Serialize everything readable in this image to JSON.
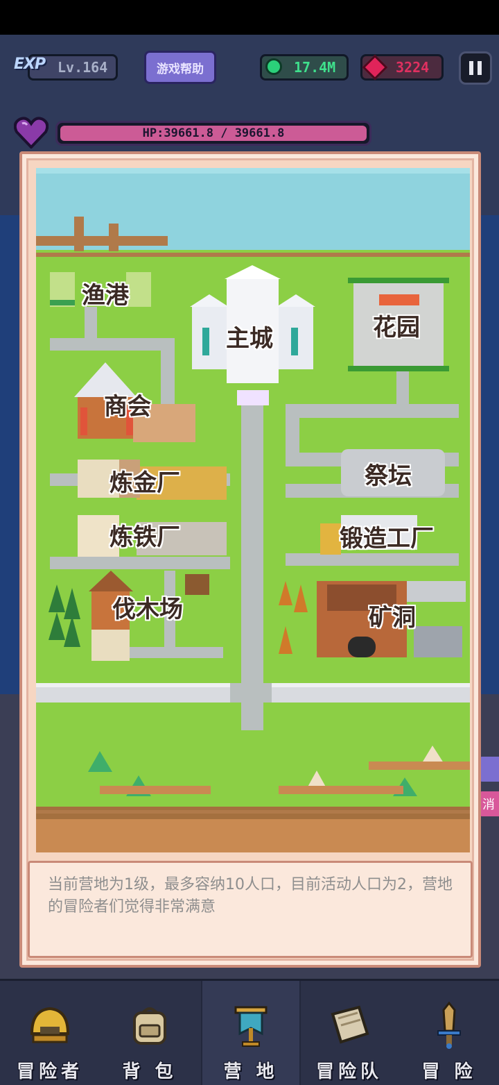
{
  "hud": {
    "exp_label": "EXP",
    "level": "Lv.164",
    "help_button": "游戏帮助",
    "gems": "17.4M",
    "rubies": "3224",
    "pause_icon": "pause-icon"
  },
  "hp": {
    "text": "HP:39661.8 / 39661.8",
    "fraction": 1.0,
    "color": "#cc5b96"
  },
  "map": {
    "labels": {
      "harbor": "渔港",
      "main_city": "主城",
      "garden": "花园",
      "guild": "商会",
      "altar": "祭坛",
      "alchemy": "炼金厂",
      "smelter": "炼铁厂",
      "forge": "锻造工厂",
      "lumber": "伐木场",
      "mine": "矿洞"
    }
  },
  "description": "当前营地为1级，最多容纳10人口，目前活动人口为2，营地的冒险者们觉得非常满意",
  "side_tab": "消",
  "nav": {
    "items": [
      {
        "label": "冒险者",
        "icon": "helmet-icon"
      },
      {
        "label": "背 包",
        "icon": "backpack-icon"
      },
      {
        "label": "营 地",
        "icon": "banner-icon"
      },
      {
        "label": "冒险队",
        "icon": "book-icon"
      },
      {
        "label": "冒 险",
        "icon": "sword-icon"
      }
    ],
    "active_index": 2
  },
  "colors": {
    "grass": "#8ccf45",
    "road": "#b9bfbf",
    "water": "#8fd3de",
    "panel": "#f6d6c2"
  }
}
